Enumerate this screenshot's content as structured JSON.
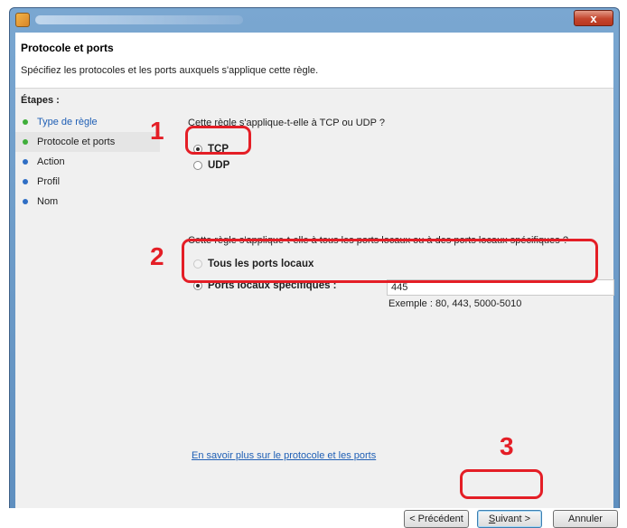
{
  "window": {
    "title_hint": "",
    "close_glyph": "x"
  },
  "header": {
    "title": "Protocole et ports",
    "subtitle": "Spécifiez les protocoles et les ports auxquels s'applique cette règle."
  },
  "steps": {
    "label": "Étapes :",
    "items": [
      {
        "label": "Type de règle",
        "state": "done"
      },
      {
        "label": "Protocole et ports",
        "state": "current"
      },
      {
        "label": "Action",
        "state": "todo"
      },
      {
        "label": "Profil",
        "state": "todo"
      },
      {
        "label": "Nom",
        "state": "todo"
      }
    ]
  },
  "protocol": {
    "question": "Cette règle s'applique-t-elle à TCP ou UDP ?",
    "options": [
      {
        "label": "TCP",
        "selected": true
      },
      {
        "label": "UDP",
        "selected": false
      }
    ]
  },
  "ports": {
    "question": "Cette règle s'applique-t-elle à tous les ports locaux ou à des ports locaux spécifiques ?",
    "all_label": "Tous les ports locaux",
    "specific_label": "Ports locaux spécifiques :",
    "value": "445",
    "example": "Exemple : 80, 443, 5000-5010"
  },
  "link": {
    "label": "En savoir plus sur le protocole et les ports"
  },
  "buttons": {
    "previous": "< Précédent",
    "next_prefix": "",
    "next_mnemonic": "S",
    "next_rest": "uivant >",
    "cancel": "Annuler"
  },
  "annotations": {
    "one": "1",
    "two": "2",
    "three": "3",
    "color": "#e41e26"
  }
}
